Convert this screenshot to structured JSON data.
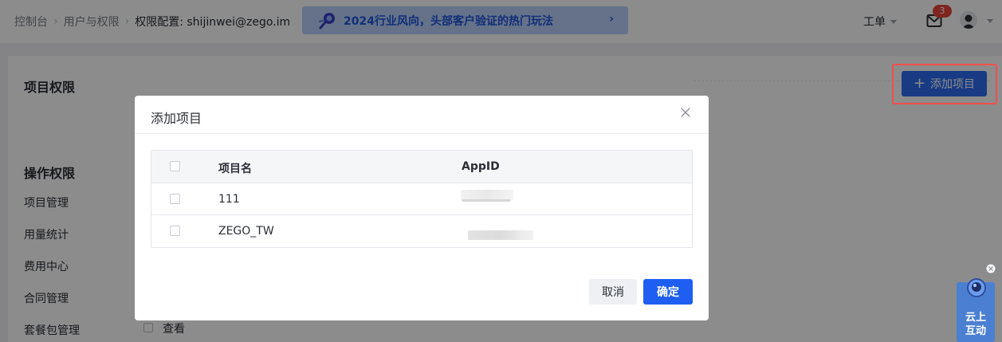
{
  "breadcrumb": {
    "items": [
      "控制台",
      "用户与权限"
    ],
    "current": "权限配置: shijinwei@zego.im"
  },
  "banner": {
    "text": "2024行业风向，头部客户验证的热门玩法",
    "arrow": "›"
  },
  "topbar": {
    "ticket_label": "工单",
    "mail_badge": "3"
  },
  "content": {
    "project_permission_title": "项目权限",
    "operation_permission_title": "操作权限",
    "add_project_label": "添加项目",
    "add_project_icon": "+",
    "permissions": [
      "项目管理",
      "用量统计",
      "费用中心",
      "合同管理",
      "套餐包管理"
    ],
    "view_label": "查看"
  },
  "modal": {
    "title": "添加项目",
    "columns": {
      "name": "项目名",
      "appid": "AppID"
    },
    "rows": [
      {
        "name": "111"
      },
      {
        "name": "ZEGO_TW"
      }
    ],
    "cancel_label": "取消",
    "confirm_label": "确定"
  },
  "widget": {
    "line1": "云上",
    "line2": "互动"
  },
  "colors": {
    "primary": "#2d6cf0",
    "banner_bg": "#b9cffb",
    "banner_text": "#1f56d8",
    "highlight": "#f0504c",
    "badge": "#e8443a"
  }
}
